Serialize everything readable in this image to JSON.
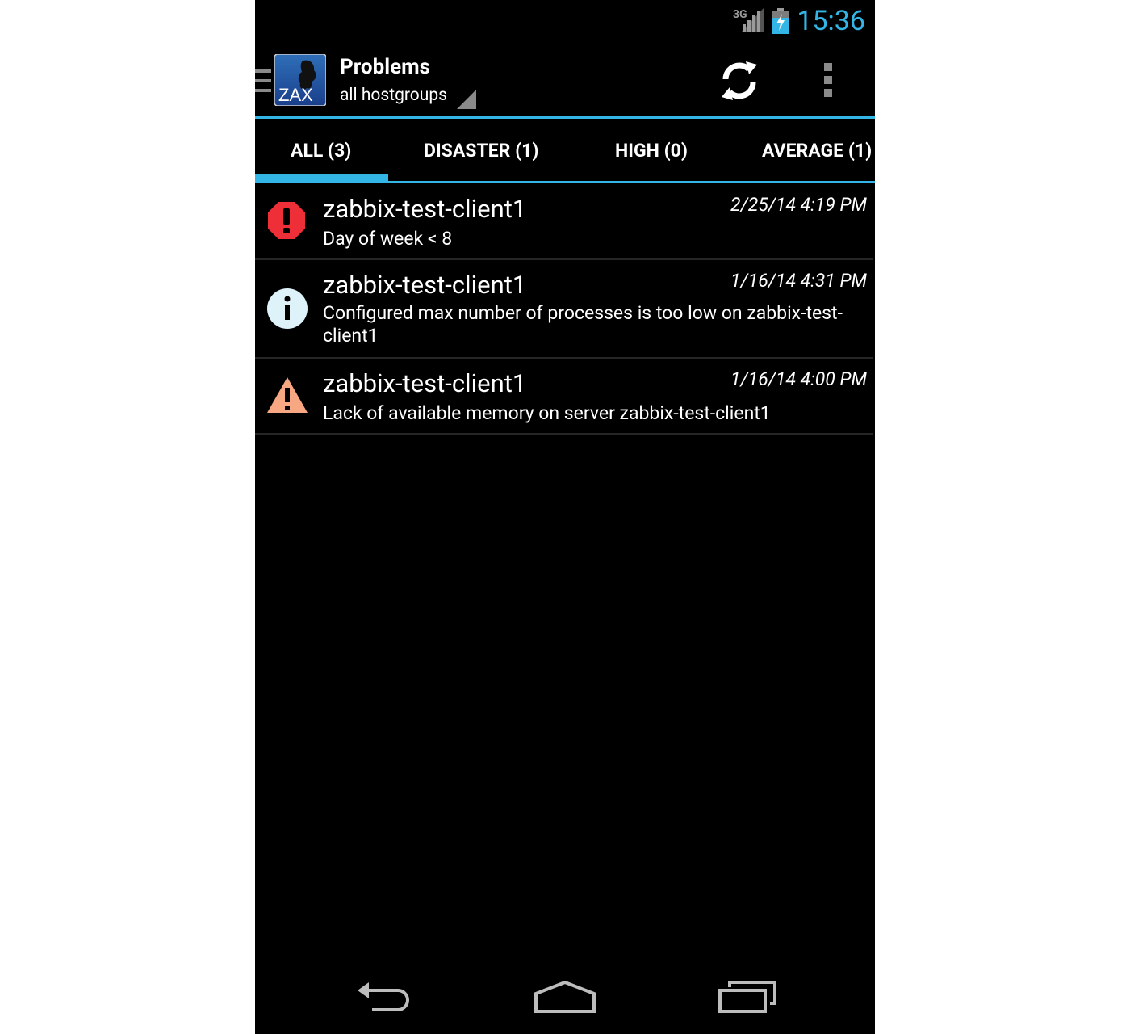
{
  "status_bar": {
    "network": "3G",
    "time": "15:36",
    "signal_icon": "signal-icon",
    "battery_icon": "battery-charging-icon"
  },
  "action_bar": {
    "title": "Problems",
    "subtitle": "all hostgroups",
    "logo_text": "ZAX",
    "drawer_icon": "drawer-menu-icon",
    "refresh_icon": "refresh-icon",
    "overflow_icon": "overflow-menu-icon"
  },
  "tabs": [
    {
      "label": "ALL (3)",
      "selected": true
    },
    {
      "label": "DISASTER (1)",
      "selected": false
    },
    {
      "label": "HIGH (0)",
      "selected": false
    },
    {
      "label": "AVERAGE (1)",
      "selected": false
    }
  ],
  "problems": [
    {
      "host": "zabbix-test-client1",
      "time": "2/25/14 4:19 PM",
      "description": "Day of week < 8",
      "severity_icon": "disaster-icon"
    },
    {
      "host": "zabbix-test-client1",
      "time": "1/16/14 4:31 PM",
      "description": "Configured max number of processes is too low on zabbix-test-client1",
      "severity_icon": "information-icon"
    },
    {
      "host": "zabbix-test-client1",
      "time": "1/16/14 4:00 PM",
      "description": "Lack of available memory on server zabbix-test-client1",
      "severity_icon": "warning-icon"
    }
  ],
  "colors": {
    "accent": "#33b5e5",
    "disaster": "#ee2f38",
    "information": "#def2fa",
    "warning": "#f8a783"
  },
  "nav_bar": {
    "back_icon": "back-icon",
    "home_icon": "home-icon",
    "recents_icon": "recent-apps-icon"
  }
}
